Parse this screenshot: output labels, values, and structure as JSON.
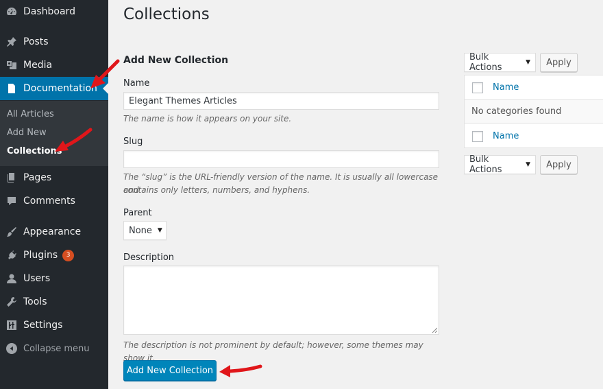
{
  "sidebar": {
    "items": [
      {
        "label": "Dashboard",
        "icon": "dashboard-icon"
      },
      {
        "label": "Posts",
        "icon": "pin-icon"
      },
      {
        "label": "Media",
        "icon": "media-icon"
      },
      {
        "label": "Documentation",
        "icon": "document-icon",
        "active": true
      },
      {
        "label": "Pages",
        "icon": "pages-icon"
      },
      {
        "label": "Comments",
        "icon": "comment-icon"
      },
      {
        "label": "Appearance",
        "icon": "brush-icon"
      },
      {
        "label": "Plugins",
        "icon": "plugin-icon",
        "badge": "3"
      },
      {
        "label": "Users",
        "icon": "user-icon"
      },
      {
        "label": "Tools",
        "icon": "wrench-icon"
      },
      {
        "label": "Settings",
        "icon": "settings-icon"
      }
    ],
    "submenu": [
      {
        "label": "All Articles"
      },
      {
        "label": "Add New"
      },
      {
        "label": "Collections",
        "current": true
      }
    ],
    "collapse_label": "Collapse menu"
  },
  "page": {
    "title": "Collections"
  },
  "form": {
    "heading": "Add New Collection",
    "name_label": "Name",
    "name_value": "Elegant Themes Articles",
    "name_help": "The name is how it appears on your site.",
    "slug_label": "Slug",
    "slug_value": "",
    "slug_help_1": "The “slug” is the URL-friendly version of the name. It is usually all lowercase and",
    "slug_help_2": "contains only letters, numbers, and hyphens.",
    "parent_label": "Parent",
    "parent_value": "None",
    "description_label": "Description",
    "description_help": "The description is not prominent by default; however, some themes may show it.",
    "submit_label": "Add New Collection"
  },
  "table": {
    "bulk_actions_label": "Bulk Actions",
    "apply_label": "Apply",
    "column_name": "Name",
    "empty_message": "No categories found"
  },
  "colors": {
    "sidebar_bg": "#23282d",
    "active_bg": "#0073aa",
    "primary_button": "#0085ba",
    "annotation_arrow": "#e0161a",
    "badge": "#d54e21"
  }
}
